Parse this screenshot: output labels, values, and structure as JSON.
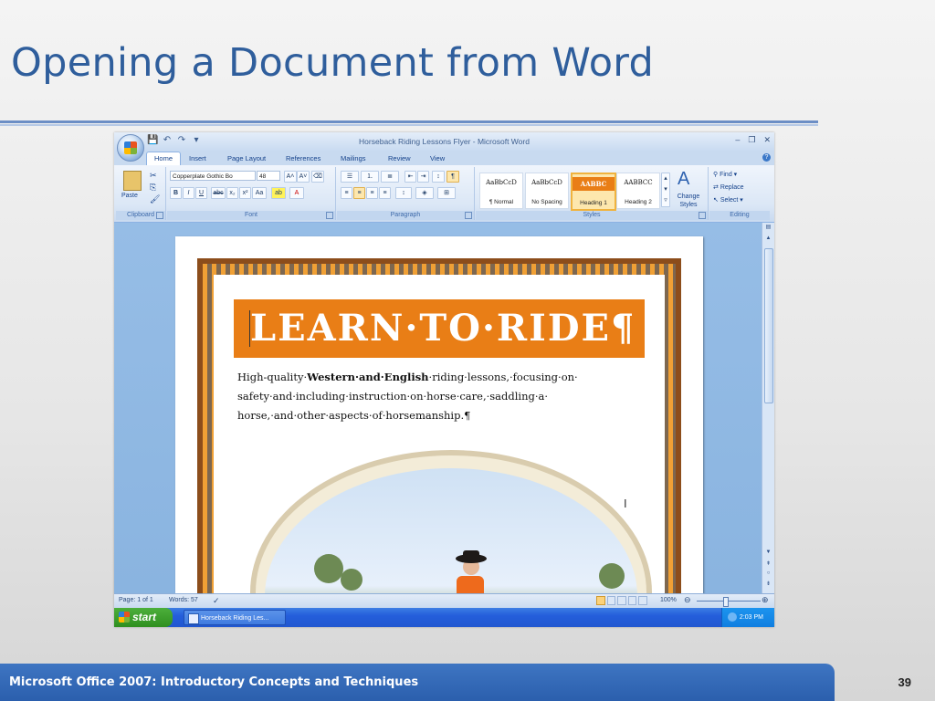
{
  "slide": {
    "title": "Opening a Document from Word",
    "footer": "Microsoft Office 2007: Introductory Concepts and Techniques",
    "number": "39"
  },
  "word": {
    "window_title": "Horseback Riding Lessons Flyer - Microsoft Word",
    "tabs": [
      "Home",
      "Insert",
      "Page Layout",
      "References",
      "Mailings",
      "Review",
      "View"
    ],
    "active_tab": "Home",
    "clipboard": {
      "paste": "Paste",
      "label": "Clipboard"
    },
    "font": {
      "name": "Copperplate Gothic Bo",
      "size": "48",
      "label": "Font"
    },
    "paragraph": {
      "label": "Paragraph"
    },
    "styles": {
      "label": "Styles",
      "items": [
        {
          "sample": "AaBbCcD",
          "name": "¶ Normal"
        },
        {
          "sample": "AaBbCcD",
          "name": "No Spacing"
        },
        {
          "sample": "AABBC",
          "name": "Heading 1"
        },
        {
          "sample": "AABBCC",
          "name": "Heading 2"
        }
      ],
      "change": "Change Styles"
    },
    "editing": {
      "find": "Find",
      "replace": "Replace",
      "select": "Select",
      "label": "Editing"
    },
    "document": {
      "headline": "LEARN·TO·RIDE¶",
      "body_prefix": "High-quality·",
      "body_bold": "Western·and·English",
      "body_suffix": "·riding·lessons,·focusing·on· safety·and·including·instruction·on·horse·care,·saddling·a· horse,·and·other·aspects·of·horsemanship.¶"
    },
    "status": {
      "page": "Page: 1 of 1",
      "words": "Words: 57",
      "zoom": "100%"
    },
    "taskbar": {
      "start": "start",
      "task": "Horseback Riding Les...",
      "clock": "2:03 PM"
    }
  },
  "colors": {
    "title": "#2f5e9c",
    "accent_orange": "#e97e16",
    "footer_blue": "#2b5fad"
  }
}
